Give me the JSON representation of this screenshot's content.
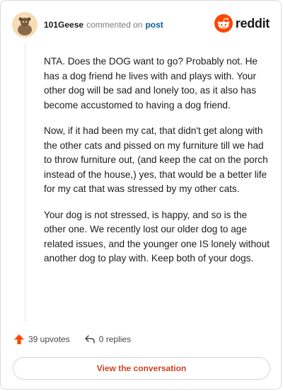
{
  "comment": {
    "username": "101Geese",
    "action_text": "commented on",
    "post_link": "post",
    "paragraphs": [
      "NTA. Does the DOG want to go? Probably not. He has a dog friend he lives with and plays with. Your other dog will be sad and lonely too, as it also has become accustomed to having a dog friend.",
      "Now, if it had been my cat, that didn't get along with the other cats and pissed on my furniture till we had to throw furniture out, (and keep the cat on the porch instead of the house,) yes, that would be a better life for my cat that was stressed by my other cats.",
      "Your dog is not stressed, is happy, and so is the other one. We recently lost our older dog to age related issues, and the younger one IS lonely without another dog to play with. Keep both of your dogs."
    ],
    "upvotes_label": "39 upvotes",
    "replies_label": "0 replies",
    "cta_label": "View the conversation"
  },
  "brand": {
    "wordmark": "reddit",
    "icon": "reddit-snoo-icon",
    "accent": "#ff4500"
  },
  "icons": {
    "avatar": "avatar",
    "upvote": "upvote-arrow-icon",
    "reply": "reply-arrow-icon"
  },
  "colors": {
    "link": "#0b5aa7",
    "cta": "#d0431f",
    "upvote": "#ff4500"
  }
}
